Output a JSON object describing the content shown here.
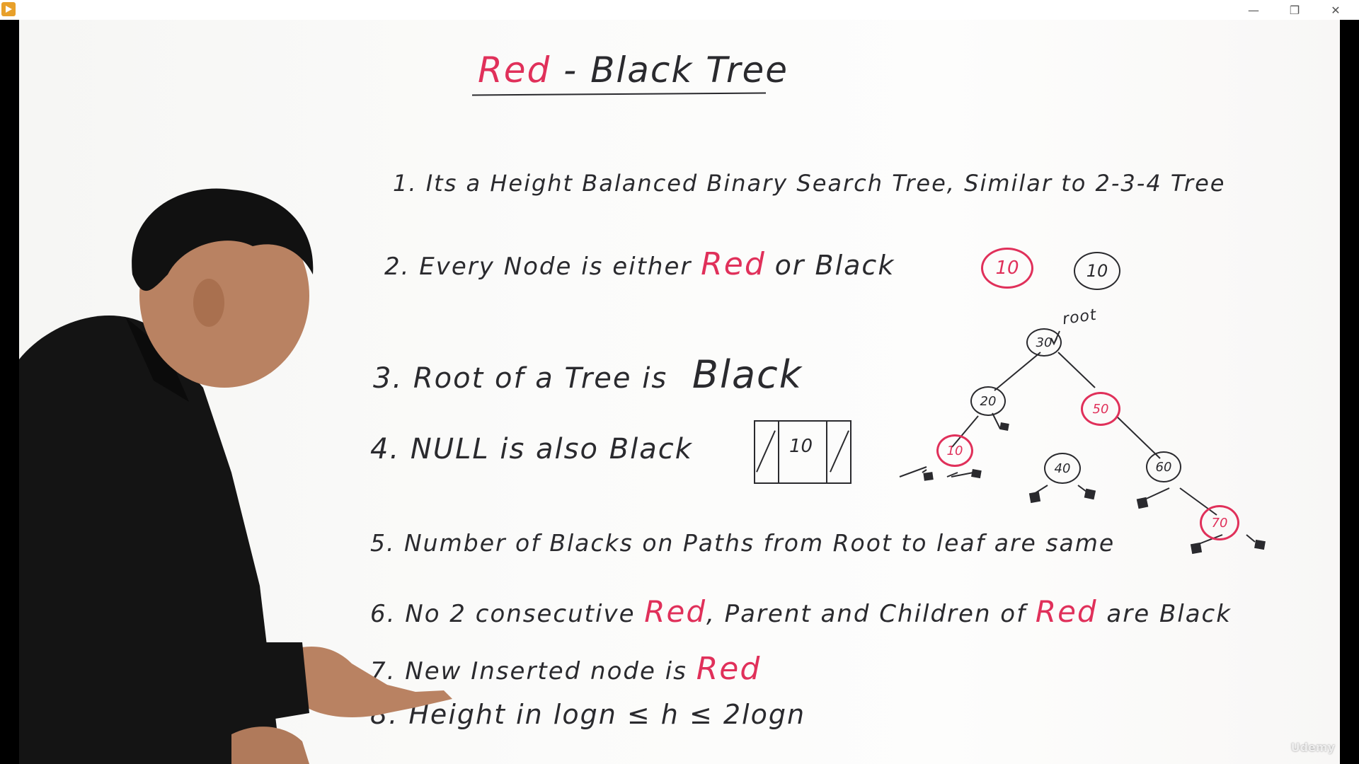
{
  "window": {
    "minimize_icon": "minimize-icon",
    "restore_icon": "restore-icon",
    "close_icon": "close-icon",
    "minimize_glyph": "—",
    "restore_glyph": "❐",
    "close_glyph": "✕"
  },
  "board": {
    "title_red": "Red",
    "title_dash": " - ",
    "title_black": "Black Tree",
    "points": [
      {
        "num": "1.",
        "text": "Its a Height Balanced Binary Search Tree, Similar to 2-3-4 Tree"
      },
      {
        "num": "2.",
        "pre": "Every Node is either",
        "red": "Red",
        "post": "or Black"
      },
      {
        "num": "3.",
        "text": "Root of a Tree is",
        "big": "Black"
      },
      {
        "num": "4.",
        "text": "NULL is also Black"
      },
      {
        "num": "5.",
        "text": "Number of Blacks on Paths from Root to leaf are same"
      },
      {
        "num": "6.",
        "pre": "No 2 consecutive",
        "red1": "Red",
        "mid": ", Parent and Children of",
        "red2": "Red",
        "post": "are Black"
      },
      {
        "num": "7.",
        "pre": "New Inserted node is",
        "red": "Red"
      },
      {
        "num": "8.",
        "text": "Height in logn ≤ h ≤ 2logn"
      }
    ],
    "example_red_node": "10",
    "example_black_node": "10",
    "null_box_value": "10",
    "root_label": "root",
    "tree_nodes": [
      {
        "id": "n30",
        "value": "30",
        "color": "black"
      },
      {
        "id": "n20",
        "value": "20",
        "color": "black"
      },
      {
        "id": "n50",
        "value": "50",
        "color": "red"
      },
      {
        "id": "n10",
        "value": "10",
        "color": "red"
      },
      {
        "id": "n40",
        "value": "40",
        "color": "black"
      },
      {
        "id": "n60",
        "value": "60",
        "color": "black"
      },
      {
        "id": "n70",
        "value": "70",
        "color": "red"
      }
    ]
  },
  "watermark": "Udemy",
  "colors": {
    "red_marker": "#e0305a",
    "black_marker": "#2a2a2e",
    "board": "#fbfbfa"
  }
}
